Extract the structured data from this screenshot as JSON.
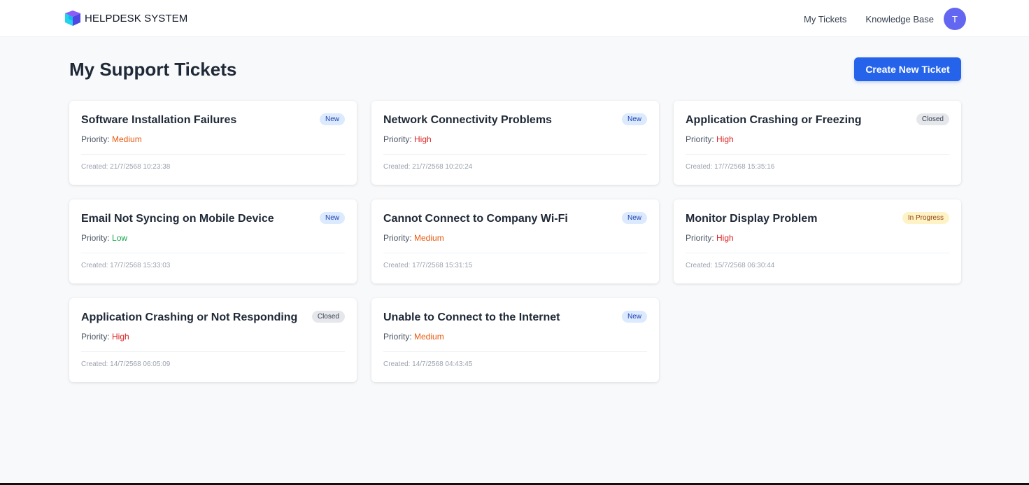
{
  "brand": {
    "name": "HELPDESK SYSTEM",
    "logo_icon": "cube-logo-icon"
  },
  "nav": {
    "my_tickets": "My Tickets",
    "knowledge_base": "Knowledge Base",
    "avatar_initial": "T"
  },
  "page": {
    "title": "My Support Tickets",
    "create_label": "Create New Ticket"
  },
  "priority_label": "Priority: ",
  "created_label": "Created: ",
  "colors": {
    "primary": "#2563eb",
    "avatar": "#6366f1",
    "high": "#dc2626",
    "medium": "#ea580c",
    "low": "#16a34a"
  },
  "tickets": [
    {
      "title": "Software Installation Failures",
      "status": "New",
      "priority": "Medium",
      "created": "21/7/2568 10:23:38"
    },
    {
      "title": "Network Connectivity Problems",
      "status": "New",
      "priority": "High",
      "created": "21/7/2568 10:20:24"
    },
    {
      "title": "Application Crashing or Freezing",
      "status": "Closed",
      "priority": "High",
      "created": "17/7/2568 15:35:16"
    },
    {
      "title": "Email Not Syncing on Mobile Device",
      "status": "New",
      "priority": "Low",
      "created": "17/7/2568 15:33:03"
    },
    {
      "title": "Cannot Connect to Company Wi-Fi",
      "status": "New",
      "priority": "Medium",
      "created": "17/7/2568 15:31:15"
    },
    {
      "title": "Monitor Display Problem",
      "status": "In Progress",
      "priority": "High",
      "created": "15/7/2568 06:30:44"
    },
    {
      "title": "Application Crashing or Not Responding",
      "status": "Closed",
      "priority": "High",
      "created": "14/7/2568 06:05:09"
    },
    {
      "title": "Unable to Connect to the Internet",
      "status": "New",
      "priority": "Medium",
      "created": "14/7/2568 04:43:45"
    }
  ]
}
